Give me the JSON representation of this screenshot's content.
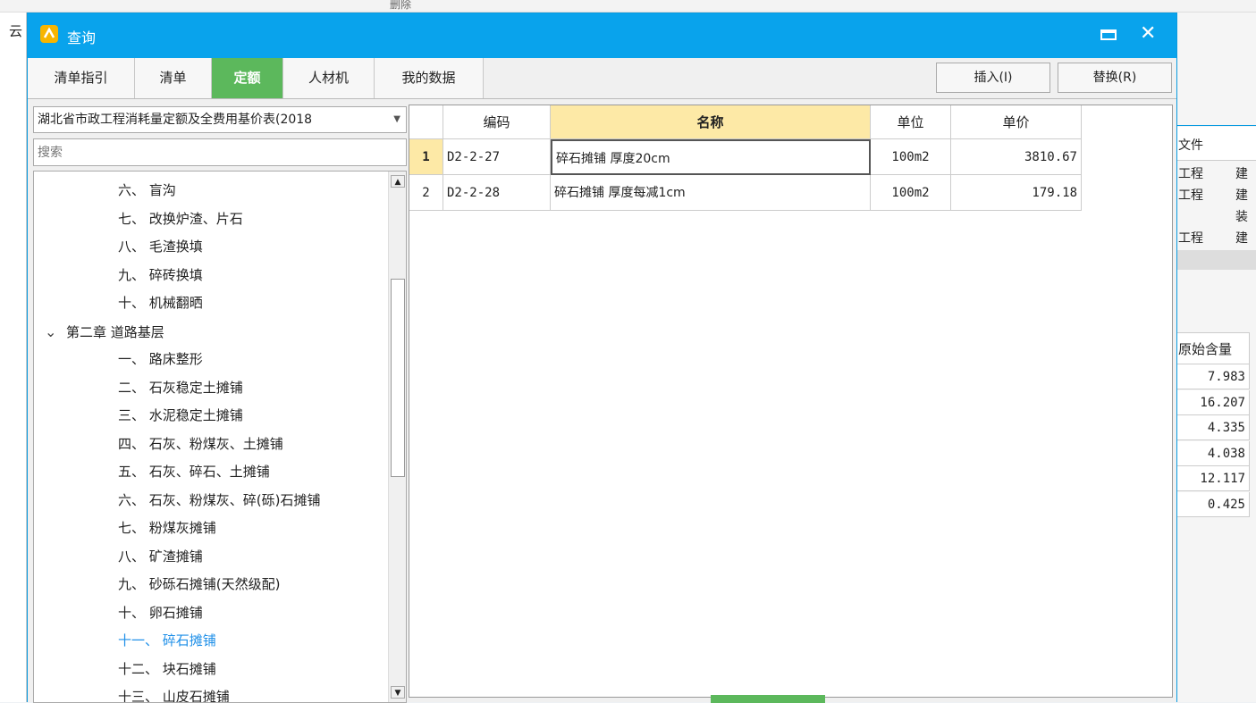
{
  "background": {
    "left_label": "云",
    "toolbar_delete": "删除",
    "right_headers": [
      "文件",
      "原始含量"
    ],
    "right_col_values": [
      "工程",
      "工程",
      "",
      "工程"
    ],
    "right_col2_values": [
      "建",
      "建",
      "装",
      "建"
    ],
    "right_content_values": [
      "7.983",
      "16.207",
      "4.335",
      "4.038",
      "12.117",
      "0.425"
    ]
  },
  "dialog": {
    "title": "查询",
    "tabs": [
      {
        "label": "清单指引",
        "active": false
      },
      {
        "label": "清单",
        "active": false
      },
      {
        "label": "定额",
        "active": true
      },
      {
        "label": "人材机",
        "active": false
      },
      {
        "label": "我的数据",
        "active": false
      }
    ],
    "insert_label": "插入(I)",
    "replace_label": "替换(R)",
    "library": "湖北省市政工程消耗量定额及全费用基价表(2018",
    "search_placeholder": "搜索",
    "tree": [
      {
        "label": "六、 盲沟",
        "level": 2
      },
      {
        "label": "七、 改换炉渣、片石",
        "level": 2
      },
      {
        "label": "八、 毛渣换填",
        "level": 2
      },
      {
        "label": "九、 碎砖换填",
        "level": 2
      },
      {
        "label": "十、 机械翻晒",
        "level": 2
      },
      {
        "label": "第二章 道路基层",
        "level": 1,
        "expanded": true
      },
      {
        "label": "一、 路床整形",
        "level": 2
      },
      {
        "label": "二、 石灰稳定土摊铺",
        "level": 2
      },
      {
        "label": "三、 水泥稳定土摊铺",
        "level": 2
      },
      {
        "label": "四、 石灰、粉煤灰、土摊铺",
        "level": 2
      },
      {
        "label": "五、 石灰、碎石、土摊铺",
        "level": 2
      },
      {
        "label": "六、 石灰、粉煤灰、碎(砾)石摊铺",
        "level": 2
      },
      {
        "label": "七、 粉煤灰摊铺",
        "level": 2
      },
      {
        "label": "八、 矿渣摊铺",
        "level": 2
      },
      {
        "label": "九、 砂砾石摊铺(天然级配)",
        "level": 2
      },
      {
        "label": "十、 卵石摊铺",
        "level": 2
      },
      {
        "label": "十一、 碎石摊铺",
        "level": 2,
        "selected": true
      },
      {
        "label": "十二、 块石摊铺",
        "level": 2
      },
      {
        "label": "十三、 山皮石摊铺",
        "level": 2
      }
    ],
    "grid": {
      "headers": [
        "编码",
        "名称",
        "单位",
        "单价"
      ],
      "rows": [
        {
          "no": "1",
          "code": "D2-2-27",
          "name": "碎石摊铺 厚度20cm",
          "unit": "100m2",
          "price": "3810.67"
        },
        {
          "no": "2",
          "code": "D2-2-28",
          "name": "碎石摊铺 厚度每减1cm",
          "unit": "100m2",
          "price": "179.18"
        }
      ]
    }
  }
}
